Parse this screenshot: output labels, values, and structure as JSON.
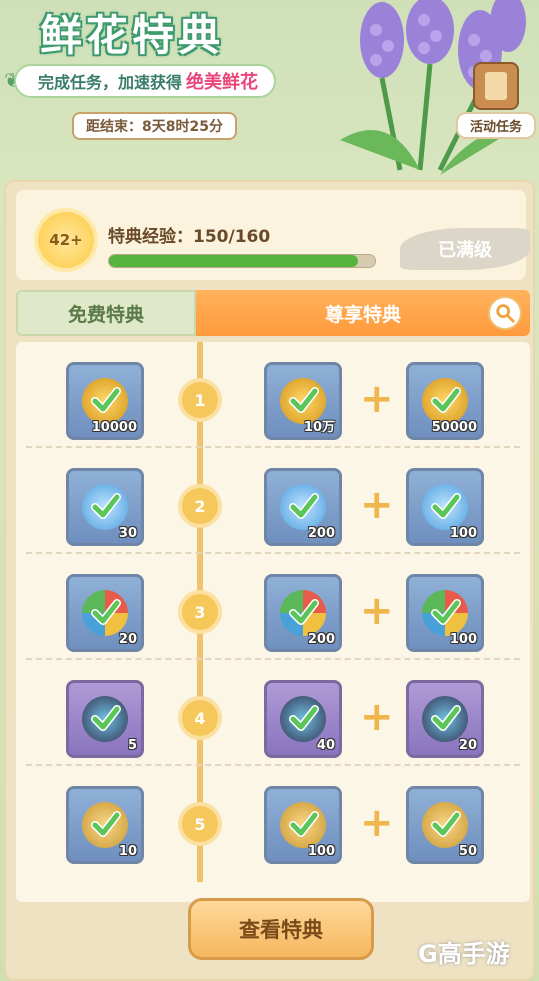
{
  "header": {
    "title": "鲜花特典",
    "subtitle_prefix": "完成任务，加速获得",
    "subtitle_highlight": "绝美鲜花",
    "countdown": "距结束：8天8时25分",
    "task_button_label": "活动任务"
  },
  "exp": {
    "level": "42+",
    "label": "特典经验：150/160",
    "progress_fraction": 0.9375,
    "maxed_label": "已满级"
  },
  "tabs": {
    "free": "免费特典",
    "vip": "尊享特典"
  },
  "rows": [
    {
      "level": "1",
      "free": {
        "icon": "gold-coin-icon",
        "count": "10000"
      },
      "vip": [
        {
          "icon": "gold-coin-icon",
          "count": "10万"
        },
        {
          "icon": "gold-coin-icon",
          "count": "50000"
        }
      ]
    },
    {
      "level": "2",
      "free": {
        "icon": "water-drop-icon",
        "count": "30"
      },
      "vip": [
        {
          "icon": "water-drop-icon",
          "count": "200"
        },
        {
          "icon": "water-drop-icon",
          "count": "100"
        }
      ]
    },
    {
      "level": "3",
      "free": {
        "icon": "pinwheel-icon",
        "count": "20"
      },
      "vip": [
        {
          "icon": "pinwheel-icon",
          "count": "200"
        },
        {
          "icon": "pinwheel-icon",
          "count": "100"
        }
      ]
    },
    {
      "level": "4",
      "free": {
        "icon": "mortar-bowl-icon",
        "count": "5"
      },
      "vip": [
        {
          "icon": "mortar-bowl-icon",
          "count": "40"
        },
        {
          "icon": "mortar-bowl-icon",
          "count": "20"
        }
      ]
    },
    {
      "level": "5",
      "free": {
        "icon": "bee-seed-icon",
        "count": "10"
      },
      "vip": [
        {
          "icon": "bee-seed-icon",
          "count": "100"
        },
        {
          "icon": "bee-seed-icon",
          "count": "50"
        }
      ]
    }
  ],
  "plus_sign": "+",
  "view_button_label": "查看特典",
  "watermark": "G高手游",
  "colors": {
    "accent_orange": "#ff9a3c",
    "progress_green": "#56b33c",
    "timeline_gold": "#f1c36a"
  }
}
